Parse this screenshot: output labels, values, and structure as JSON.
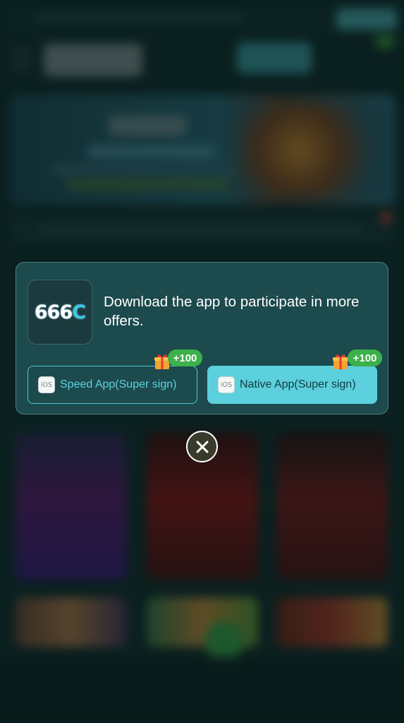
{
  "modal": {
    "logo_text": "666",
    "logo_c": "C",
    "message": "Download the app to participate in more offers.",
    "speed_button": {
      "icon_label": "iOS",
      "label": "Speed App(Super sign)",
      "badge": "+100"
    },
    "native_button": {
      "icon_label": "iOS",
      "label": "Native App(Super sign)",
      "badge": "+100"
    }
  },
  "icons": {
    "gift": "gift-icon",
    "ios": "ios-icon",
    "close": "close-icon"
  },
  "colors": {
    "accent": "#5cd0dc",
    "badge": "#3cb04a",
    "modal_bg": "#1c4a4d"
  }
}
